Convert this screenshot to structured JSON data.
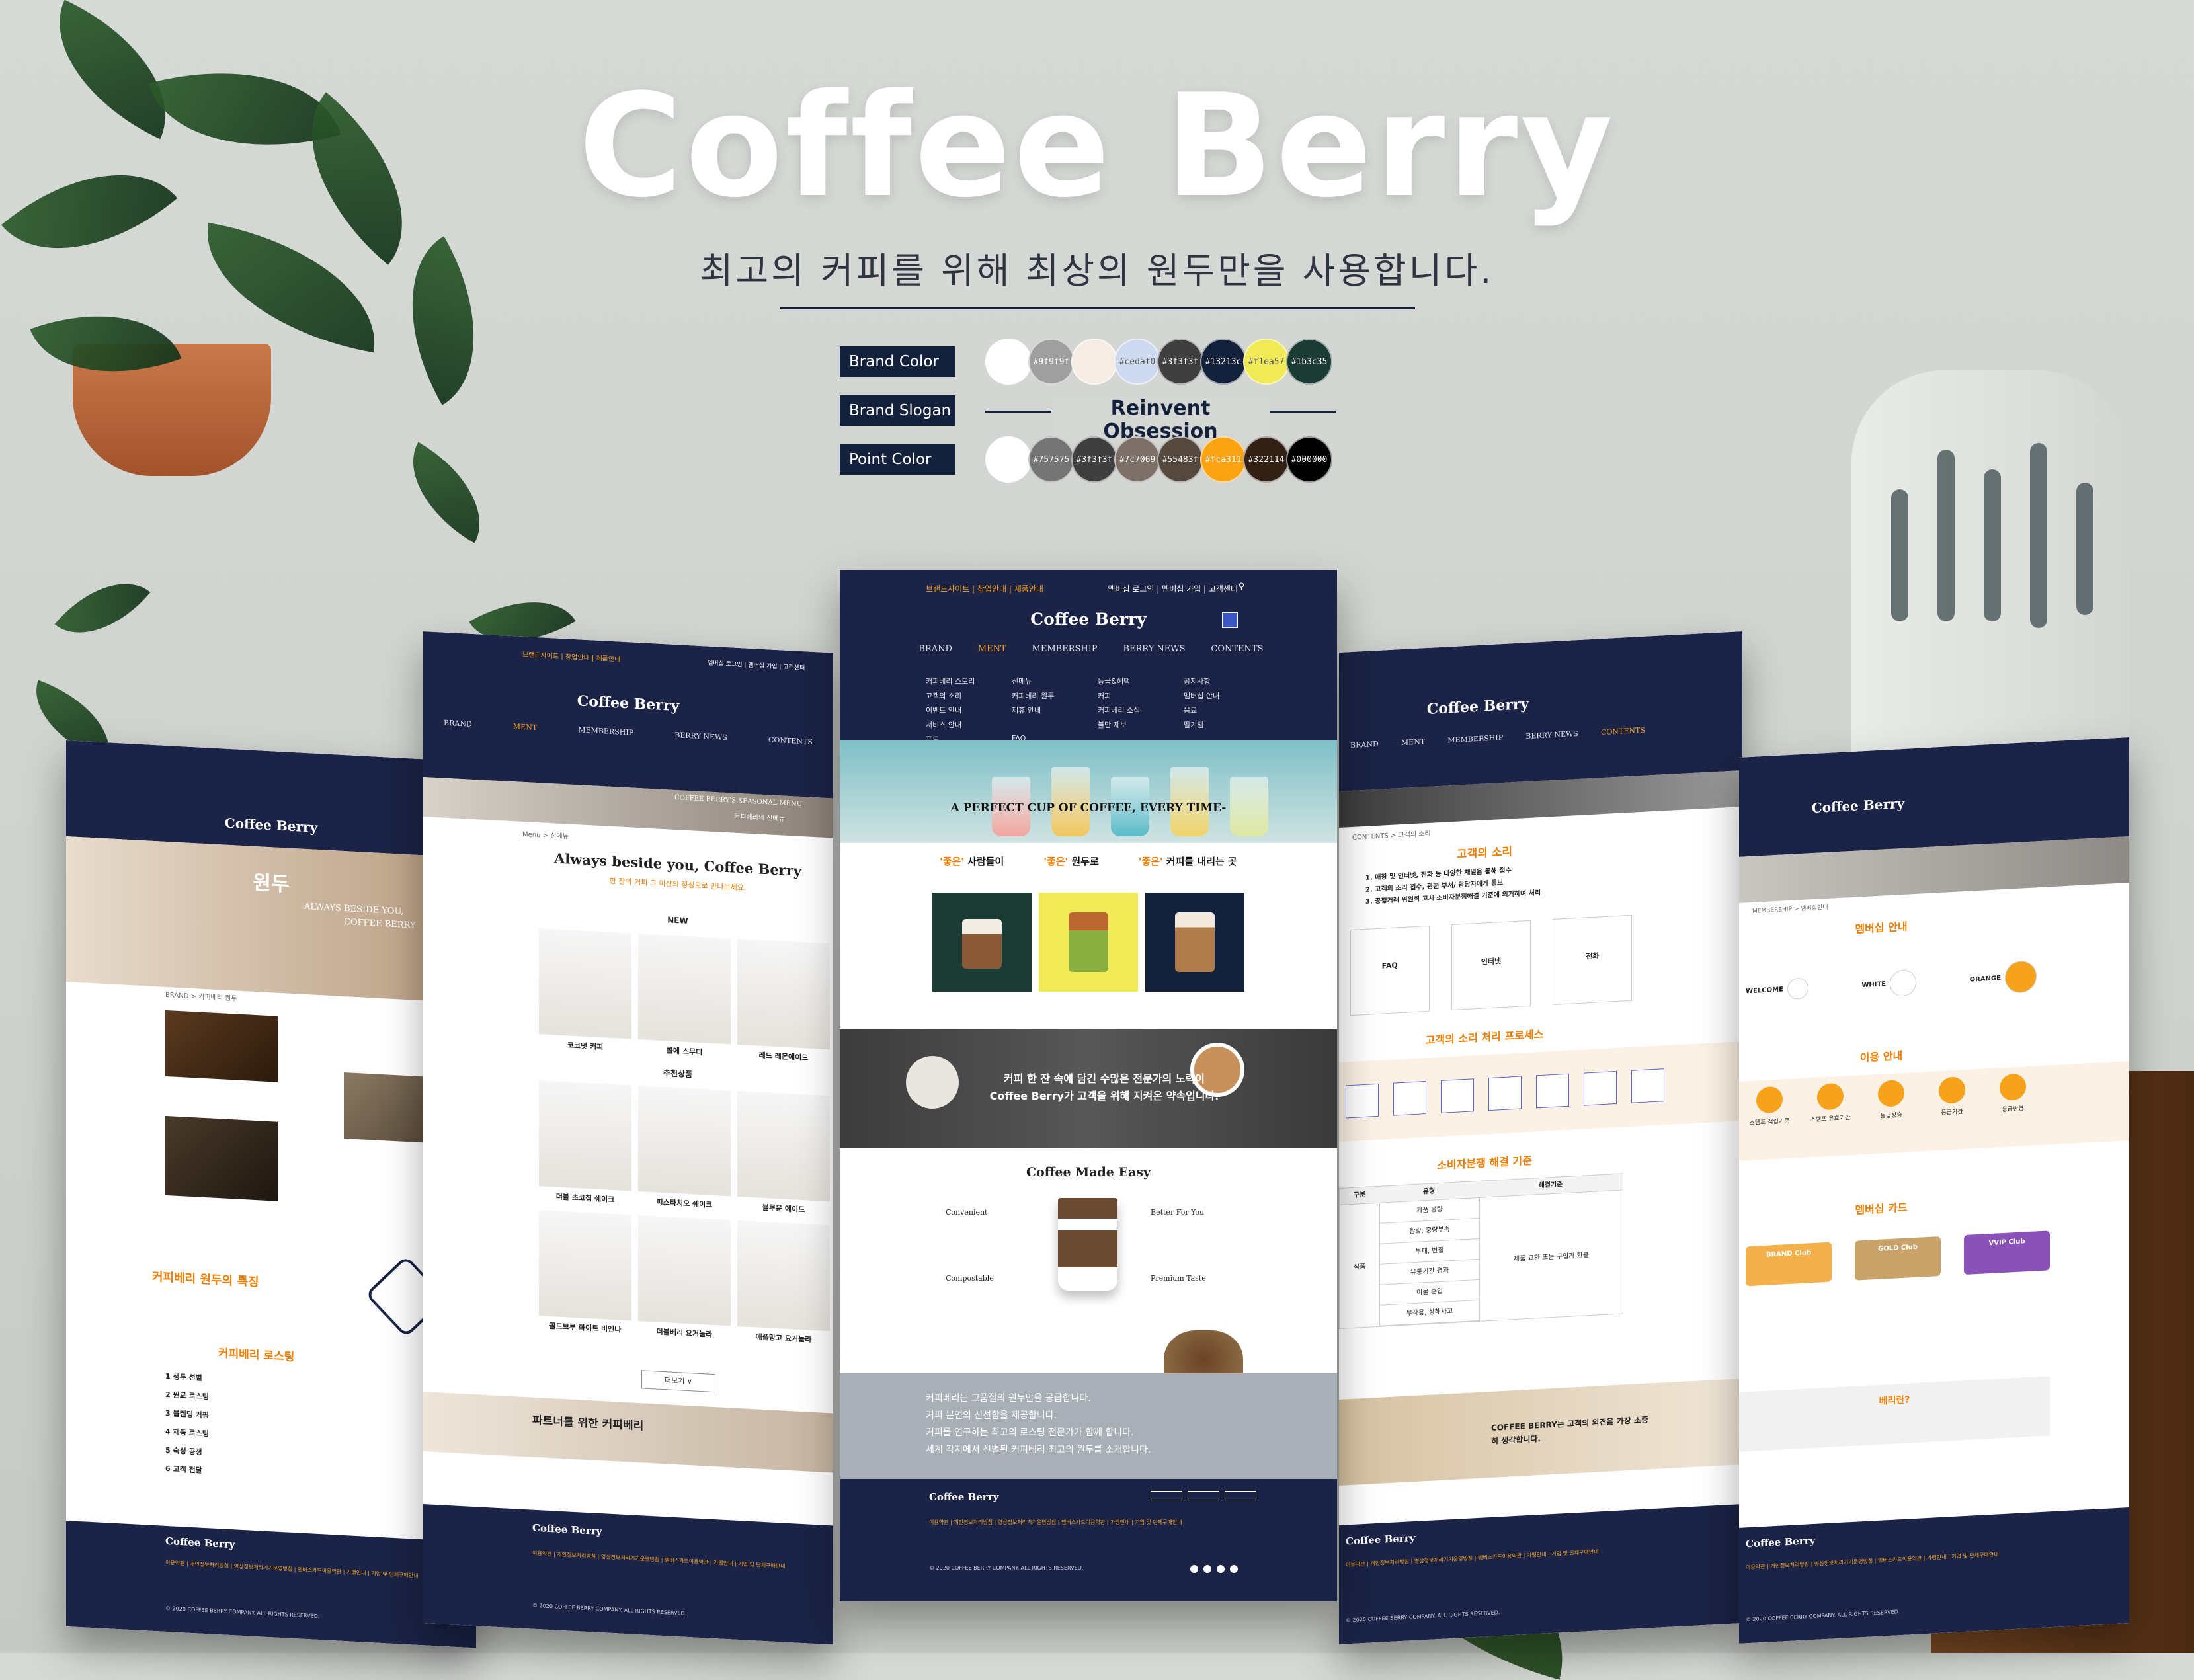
{
  "hero": {
    "title": "Coffee Berry",
    "subtitle": "최고의 커피를 위해 최상의 원두만을 사용합니다."
  },
  "palette": {
    "brand_color_label": "Brand Color",
    "brand_colors": [
      {
        "code": "#ffffff",
        "label": ""
      },
      {
        "code": "#9f9f9f",
        "label": "#9f9f9f"
      },
      {
        "code": "#f5ede3",
        "label": ""
      },
      {
        "code": "#cedaf0",
        "label": "#cedaf0"
      },
      {
        "code": "#3f3f3f",
        "label": "#3f3f3f"
      },
      {
        "code": "#13213c",
        "label": "#13213c"
      },
      {
        "code": "#f1ea57",
        "label": "#f1ea57"
      },
      {
        "code": "#1b3c35",
        "label": "#1b3c35"
      }
    ],
    "brand_slogan_label": "Brand Slogan",
    "brand_slogan": "Reinvent Obsession",
    "point_color_label": "Point Color",
    "point_colors": [
      {
        "code": "#ffffff",
        "label": ""
      },
      {
        "code": "#757575",
        "label": "#757575"
      },
      {
        "code": "#3f3f3f",
        "label": "#3f3f3f"
      },
      {
        "code": "#7c7069",
        "label": "#7c7069"
      },
      {
        "code": "#55483f",
        "label": "#55483f"
      },
      {
        "code": "#fca311",
        "label": "#fca311"
      },
      {
        "code": "#322114",
        "label": "#322114"
      },
      {
        "code": "#000000",
        "label": "#000000"
      }
    ]
  },
  "common": {
    "logo": "Coffee Berry",
    "top_links": "브랜드사이트 | 창업안내 | 제품안내",
    "top_right": "멤버십 로그인 | 멤버십 가입 | 고객센터",
    "nav": [
      "BRAND",
      "MENT",
      "MEMBERSHIP",
      "BERRY NEWS",
      "CONTENTS"
    ],
    "footer_links": "이용약관 | 개인정보처리방침 | 영상정보처리기기운영방침 | 멤버스카드이용약관 | 가맹안내 | 기업 및 단체구매안내",
    "footer_copy": "© 2020 COFFEE BERRY COMPANY. ALL RIGHTS RESERVED."
  },
  "center": {
    "submenu": [
      "커피베리 스토리",
      "신메뉴",
      "등급&혜택",
      "공지사항",
      "고객의 소리",
      "커피베리 원두",
      "커피",
      "멤버십 안내",
      "이벤트 안내",
      "제휴 안내",
      "커피베리 소식",
      "음료",
      "서비스 안내",
      "",
      "불만 제보",
      "딸기잼",
      "푸드",
      "FAQ",
      "",
      ""
    ],
    "ticker": "A PERFECT CUP OF COFFEE, EVERY TIME-",
    "three": [
      {
        "o": "'좋은'",
        "t": " 사람들이"
      },
      {
        "o": "'좋은'",
        "t": " 원두로"
      },
      {
        "o": "'좋은'",
        "t": " 커피를 내리는 곳"
      }
    ],
    "band_text_1": "커피 한 잔 속에 담긴 수많은 전문가의 노력이",
    "band_text_2": "Coffee Berry가 고객을 위해 지켜온 약속입니다.",
    "easy_title": "Coffee Made Easy",
    "easy_items": [
      "Convenient",
      "Better For You",
      "Compostable",
      "Premium Taste"
    ],
    "gray_lines": [
      "커피베리는 고품질의 원두만을 공급합니다.",
      "커피 본연의 신선함을 제공합니다.",
      "커피를 연구하는 최고의 로스팅 전문가가 함께 합니다.",
      "세계 각지에서 선별된 커피베리 최고의 원두를 소개합니다."
    ]
  },
  "left_page": {
    "banner_title": "원두",
    "banner_sub_1": "ALWAYS BESIDE YOU,",
    "banner_sub_2": "COFFEE BERRY",
    "breadcrumb": "BRAND > 커피베리 원두",
    "feature_title": "커피베리 원두의 특징",
    "roasting_title": "커피베리 로스팅",
    "steps": [
      "1 생두 선별",
      "2 원료 로스팅",
      "3 블렌딩 커핑",
      "4 제품 로스팅",
      "5 숙성 공정",
      "6 고객 전달"
    ]
  },
  "left2_page": {
    "breadcrumb": "Menu > 신메뉴",
    "banner_title": "COFFEE BERRY'S SEASONAL MENU",
    "banner_sub": "커피베리의 신메뉴",
    "heading": "Always beside you, Coffee Berry",
    "subheading": "한 잔의 커피 그 이상의 정성으로 만나보세요.",
    "new_label": "NEW",
    "new_items": [
      "코코넛 커피",
      "콜메 스무디",
      "레드 레몬에이드"
    ],
    "rec_label": "추천상품",
    "rec_items": [
      "더블 초코칩 쉐이크",
      "피스타치오 쉐이크",
      "블루문 에이드",
      "콜드브루 화이트 비엔나",
      "더블베리 요거놀라",
      "애플망고 요거놀라"
    ],
    "more": "더보기 ∨",
    "partner_title": "파트너를 위한 커피베리"
  },
  "right2_page": {
    "breadcrumb": "CONTENTS > 고객의 소리",
    "voc_title": "고객의 소리",
    "voc_lines": [
      "1. 매장 및 인터넷, 전화 등 다양한 채널을 통해 접수",
      "2. 고객의 소리 접수, 관련 부서/ 담당자에게 통보",
      "3. 공평거래 위원회 고시 소비자분쟁해결 기준에 의거하여 처리"
    ],
    "voc_cards": [
      "FAQ",
      "인터넷",
      "전화"
    ],
    "process_title": "고객의 소리 처리 프로세스",
    "standard_title": "소비자분쟁 해결 기준",
    "table_head": [
      "구분",
      "유형",
      "해결기준"
    ],
    "table_rows": [
      "제품 불량",
      "함량, 중량부족",
      "부패, 변질",
      "유통기간 경과",
      "이물 혼입",
      "부작용, 상해사고"
    ],
    "table_cat": "식품",
    "table_solution": "제품 교환 또는 구입가 환불",
    "banner": "COFFEE BERRY는 고객의 의견을 가장 소중히 생각합니다."
  },
  "right_page": {
    "breadcrumb": "MEMBERSHIP > 멤버십안내",
    "title": "멤버십 안내",
    "tiers": [
      "WELCOME",
      "WHITE",
      "ORANGE"
    ],
    "usage_title": "이용 안내",
    "usage_items": [
      "스템프 적립기준",
      "스템프 유효기간",
      "등급상승",
      "등급기간",
      "등급변경"
    ],
    "card_title": "멤버십 카드",
    "cards": [
      "BRAND Club",
      "GOLD Club",
      "VVIP Club"
    ],
    "berry_title": "베리란?"
  }
}
